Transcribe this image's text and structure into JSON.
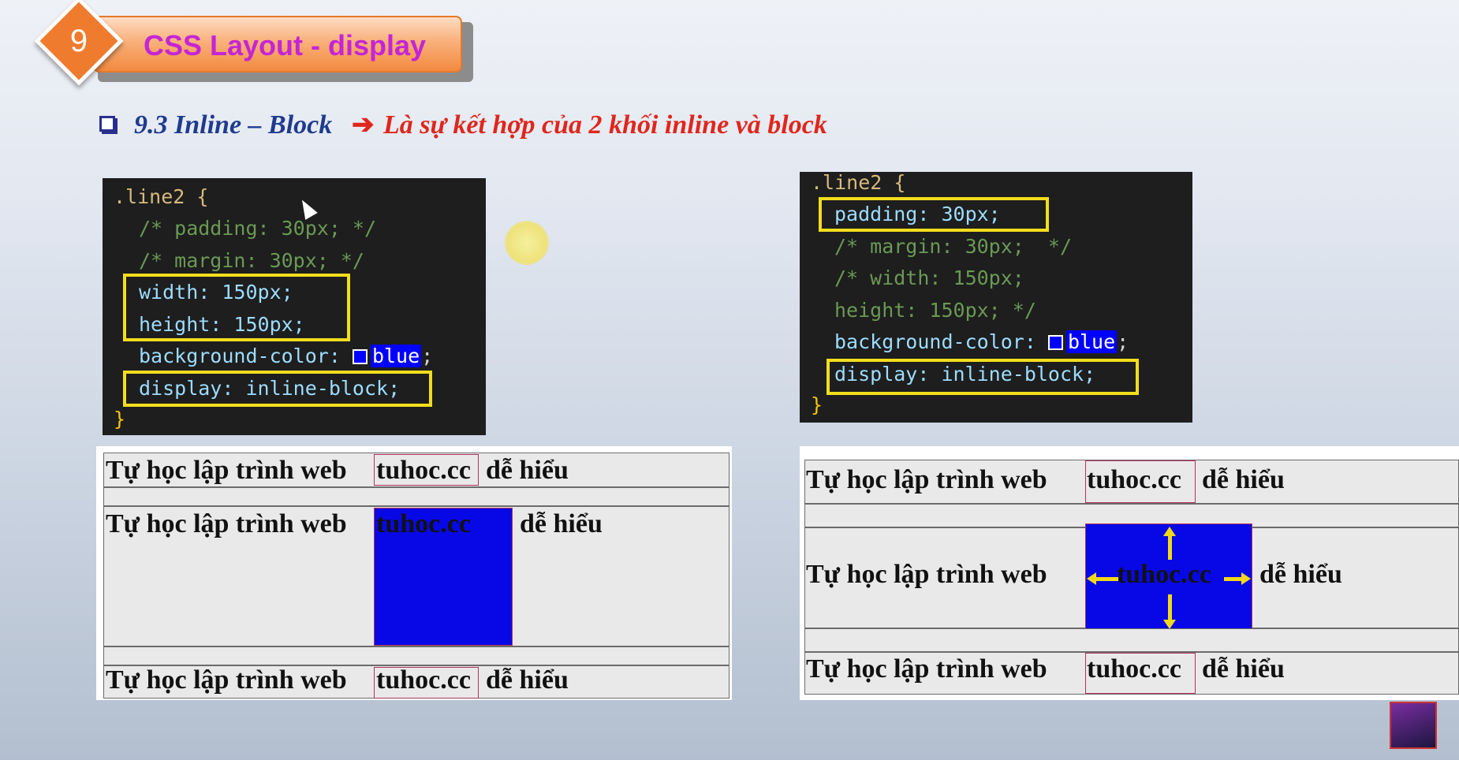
{
  "header": {
    "section_number": "9",
    "title": "CSS Layout - display"
  },
  "subtitle": {
    "part1": "9.3 Inline – Block",
    "arrow": "➔",
    "part2": "Là sự kết hợp của 2 khối inline và block"
  },
  "left_code": {
    "selector": ".line2 {",
    "lines": [
      "/* padding: 30px; */",
      "/* margin: 30px; */",
      "width: 150px;",
      "height: 150px;",
      "background-color:",
      "blue",
      "display: inline-block;",
      "}"
    ]
  },
  "right_code": {
    "selector": ".line2 {",
    "lines": [
      "padding: 30px;",
      "/* margin: 30px;  */",
      "/* width: 150px;",
      "height: 150px; */",
      "background-color:",
      "blue",
      "display: inline-block;",
      "}"
    ]
  },
  "demo": {
    "text_before": "Tự học lập trình web",
    "span_text": "tuhoc.cc",
    "text_after": "dễ hiểu"
  },
  "colors": {
    "accent_orange": "#ef7b2e",
    "title_magenta": "#c425d6",
    "highlight_yellow": "#f2de1c",
    "box_blue": "#0808e6"
  }
}
